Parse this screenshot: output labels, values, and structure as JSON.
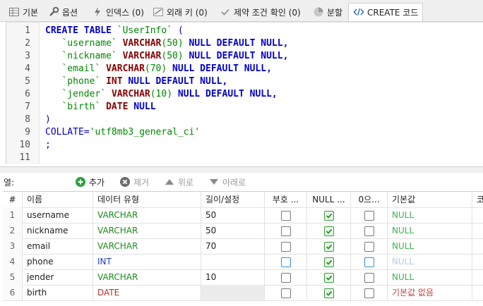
{
  "tabs": [
    {
      "label": "기본",
      "icon": "table-icon"
    },
    {
      "label": "옵션",
      "icon": "wrench-icon"
    },
    {
      "label": "인덱스 (0)",
      "icon": "lightning-icon"
    },
    {
      "label": "외래 키 (0)",
      "icon": "foreign-key-icon"
    },
    {
      "label": "제약 조건 확인 (0)",
      "icon": "check-icon"
    },
    {
      "label": "분할",
      "icon": "pie-icon"
    },
    {
      "label": "CREATE 코드",
      "icon": "code-icon"
    }
  ],
  "editor": {
    "line_numbers": [
      "1",
      "2",
      "3",
      "4",
      "5",
      "6",
      "7",
      "8",
      "9",
      "10",
      "11"
    ],
    "sql": {
      "l1_kw": "CREATE TABLE",
      "l1_id": "`UserInfo`",
      "l1_p": "(",
      "l2_id": "`username`",
      "l2_ty": "VARCHAR",
      "l2_n": "(50)",
      "l2_rest": "NULL DEFAULT NULL,",
      "l3_id": "`nickname`",
      "l3_ty": "VARCHAR",
      "l3_n": "(50)",
      "l3_rest": "NULL DEFAULT NULL,",
      "l4_id": "`email`",
      "l4_ty": "VARCHAR",
      "l4_n": "(70)",
      "l4_rest": "NULL DEFAULT NULL,",
      "l5_id": "`phone`",
      "l5_ty": "INT",
      "l5_rest": "NULL DEFAULT NULL,",
      "l6_id": "`jender`",
      "l6_ty": "VARCHAR",
      "l6_n": "(10)",
      "l6_rest": "NULL DEFAULT NULL,",
      "l7_id": "`birth`",
      "l7_ty": "DATE",
      "l7_rest": "NULL",
      "l8": ")",
      "l9_kw": "COLLATE=",
      "l9_str": "'utf8mb3_general_ci'",
      "l10": ";"
    }
  },
  "columns_bar": {
    "label": "열:",
    "add": "추가",
    "remove": "제거",
    "up": "위로",
    "down": "아래로"
  },
  "grid": {
    "headers": [
      "#",
      "이름",
      "데이터 유형",
      "길이/설정",
      "부호 ...",
      "NULL ...",
      "0으...",
      "기본값",
      "코"
    ],
    "rows": [
      {
        "num": "1",
        "name": "username",
        "type": "VARCHAR",
        "len": "50",
        "unsigned": false,
        "null": true,
        "zerofill": false,
        "default": "NULL"
      },
      {
        "num": "2",
        "name": "nickname",
        "type": "VARCHAR",
        "len": "50",
        "unsigned": false,
        "null": true,
        "zerofill": false,
        "default": "NULL"
      },
      {
        "num": "3",
        "name": "email",
        "type": "VARCHAR",
        "len": "70",
        "unsigned": false,
        "null": true,
        "zerofill": false,
        "default": "NULL"
      },
      {
        "num": "4",
        "name": "phone",
        "type": "INT",
        "len": "",
        "unsigned": false,
        "null": true,
        "zerofill": false,
        "default": "NULL"
      },
      {
        "num": "5",
        "name": "jender",
        "type": "VARCHAR",
        "len": "10",
        "unsigned": false,
        "null": true,
        "zerofill": false,
        "default": "NULL"
      },
      {
        "num": "6",
        "name": "birth",
        "type": "DATE",
        "len": "",
        "unsigned": false,
        "null": true,
        "zerofill": false,
        "default": "기본값 없음"
      }
    ]
  }
}
